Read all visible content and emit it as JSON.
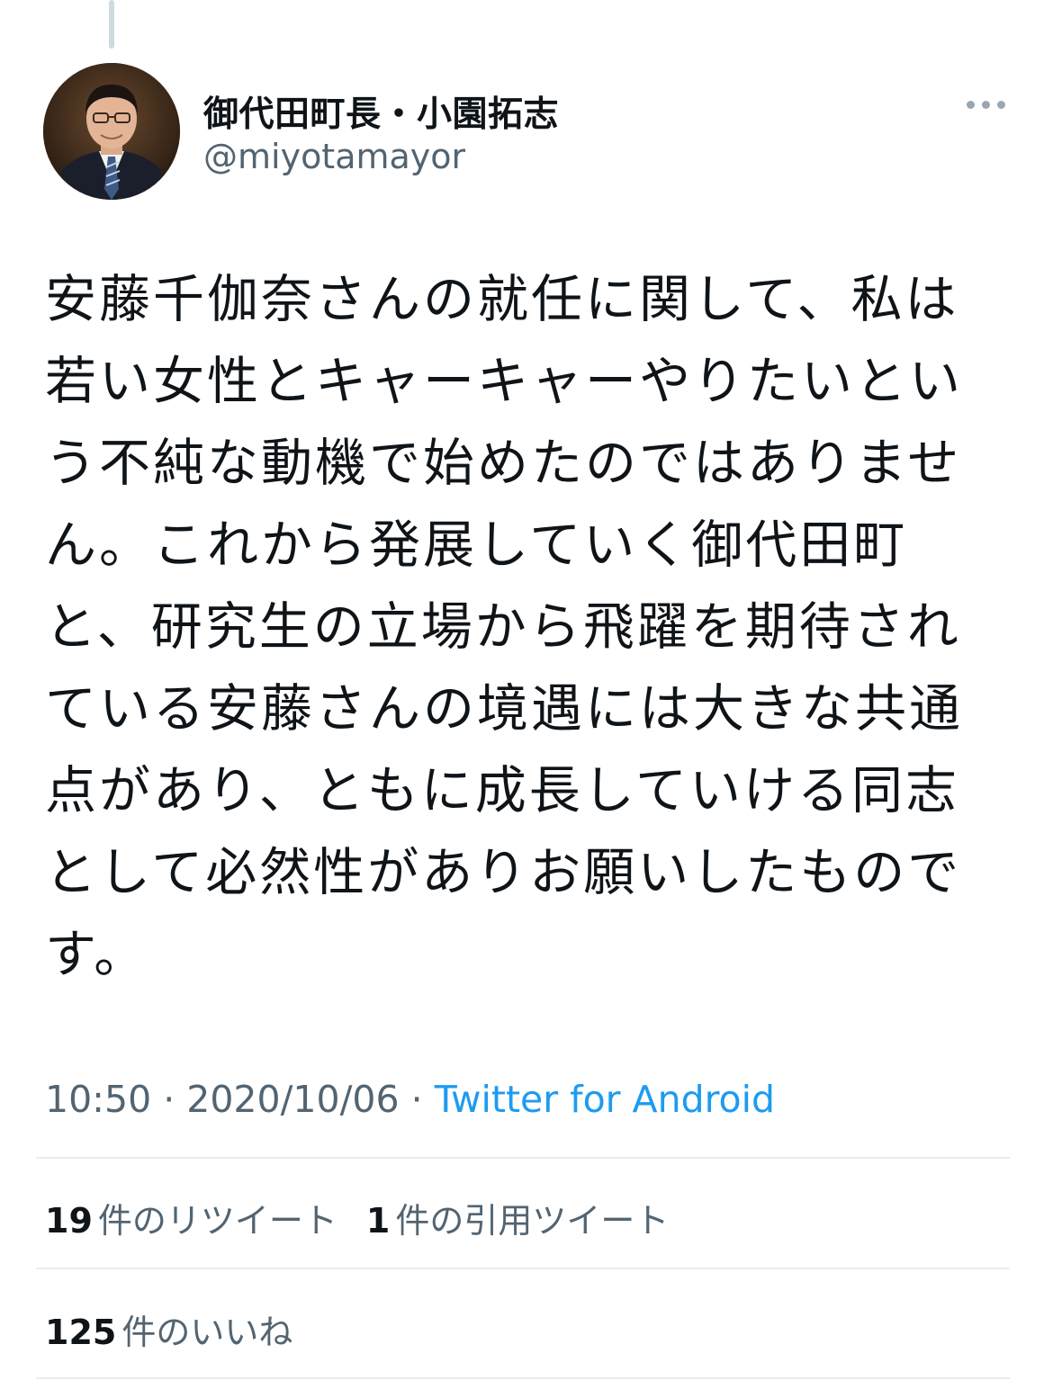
{
  "author": {
    "display_name": "御代田町長・小園拓志",
    "handle": "@miyotamayor"
  },
  "icons": {
    "more": "more-horizontal-icon"
  },
  "tweet": {
    "text": "安藤千伽奈さんの就任に関して、私は若い女性とキャーキャーやりたいという不純な動機で始めたのではありません。これから発展していく御代田町と、研究生の立場から飛躍を期待されている安藤さんの境遇には大きな共通点があり、ともに成長していける同志として必然性がありお願いしたものです。"
  },
  "meta": {
    "time": "10:50",
    "separator": " · ",
    "date": "2020/10/06",
    "source": "Twitter for Android"
  },
  "stats": {
    "retweets": {
      "count": "19",
      "label": "件のリツイート"
    },
    "quotes": {
      "count": "1",
      "label": "件の引用ツイート"
    },
    "likes": {
      "count": "125",
      "label": "件のいいね"
    }
  },
  "colors": {
    "link": "#1d9bf0",
    "secondary_text": "#536471",
    "primary_text": "#0f1419",
    "divider": "#e6ecf0"
  }
}
